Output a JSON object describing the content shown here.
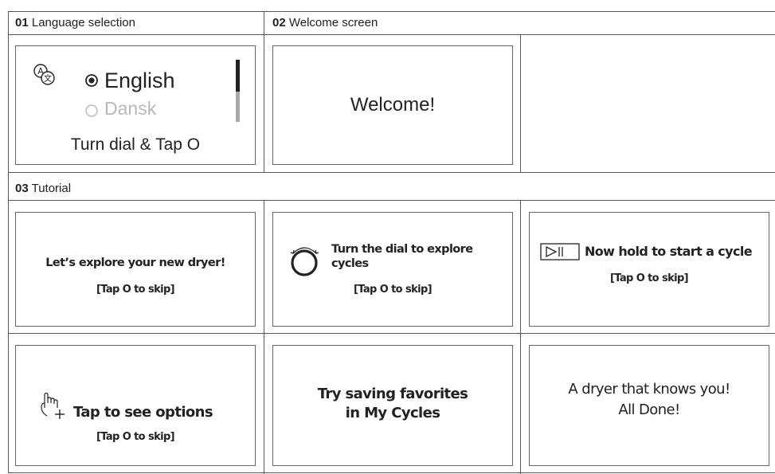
{
  "sections": {
    "s1": {
      "num": "01",
      "title": "Language selection"
    },
    "s2": {
      "num": "02",
      "title": "Welcome screen"
    },
    "s3": {
      "num": "03",
      "title": "Tutorial"
    }
  },
  "language_screen": {
    "selected_language": "English",
    "other_language": "Dansk",
    "instruction": "Turn dial & Tap O",
    "icon": "language-icon"
  },
  "welcome_screen": {
    "text": "Welcome!"
  },
  "tutorial": {
    "screen1": {
      "line1": "Let’s explore your new dryer!",
      "skip": "[Tap O to skip]"
    },
    "screen2": {
      "line1": "Turn the dial to explore",
      "line2": "cycles",
      "skip": "[Tap O to skip]",
      "icon": "dial-rotate-icon"
    },
    "screen3": {
      "line1": "Now hold to start a cycle",
      "skip": "[Tap O to skip]",
      "icon": "play-pause-icon"
    },
    "screen4": {
      "line1": "Tap to see options",
      "skip": "[Tap O to skip]",
      "icon": "tap-hand-icon"
    },
    "screen5": {
      "line1": "Try saving favorites",
      "line2": "in My Cycles"
    },
    "screen6": {
      "line1": "A dryer that knows you!",
      "line2": "All Done!"
    }
  }
}
